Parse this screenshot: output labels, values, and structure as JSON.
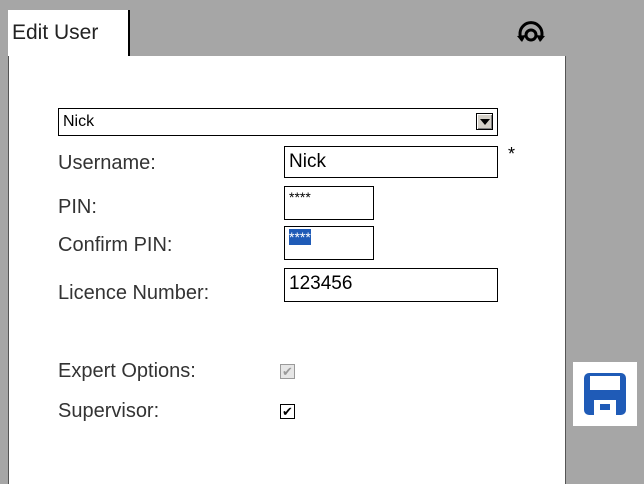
{
  "tab": {
    "title": "Edit User"
  },
  "user_select": {
    "value": "Nick"
  },
  "form": {
    "username_label": "Username:",
    "username_value": "Nick",
    "required_marker": "*",
    "pin_label": "PIN:",
    "pin_value": "****",
    "confirm_pin_label": "Confirm PIN:",
    "confirm_pin_value": "****",
    "licence_label": "Licence Number:",
    "licence_value": "123456",
    "expert_options_label": "Expert Options:",
    "expert_options_checked": true,
    "expert_options_enabled": false,
    "supervisor_label": "Supervisor:",
    "supervisor_checked": true
  },
  "icons": {
    "sync": "sync-icon",
    "save": "save-icon",
    "dropdown": "chevron-down-icon"
  },
  "colors": {
    "selection": "#1f5bb7",
    "save_icon": "#1f5bb7",
    "background": "#a6a6a6"
  }
}
